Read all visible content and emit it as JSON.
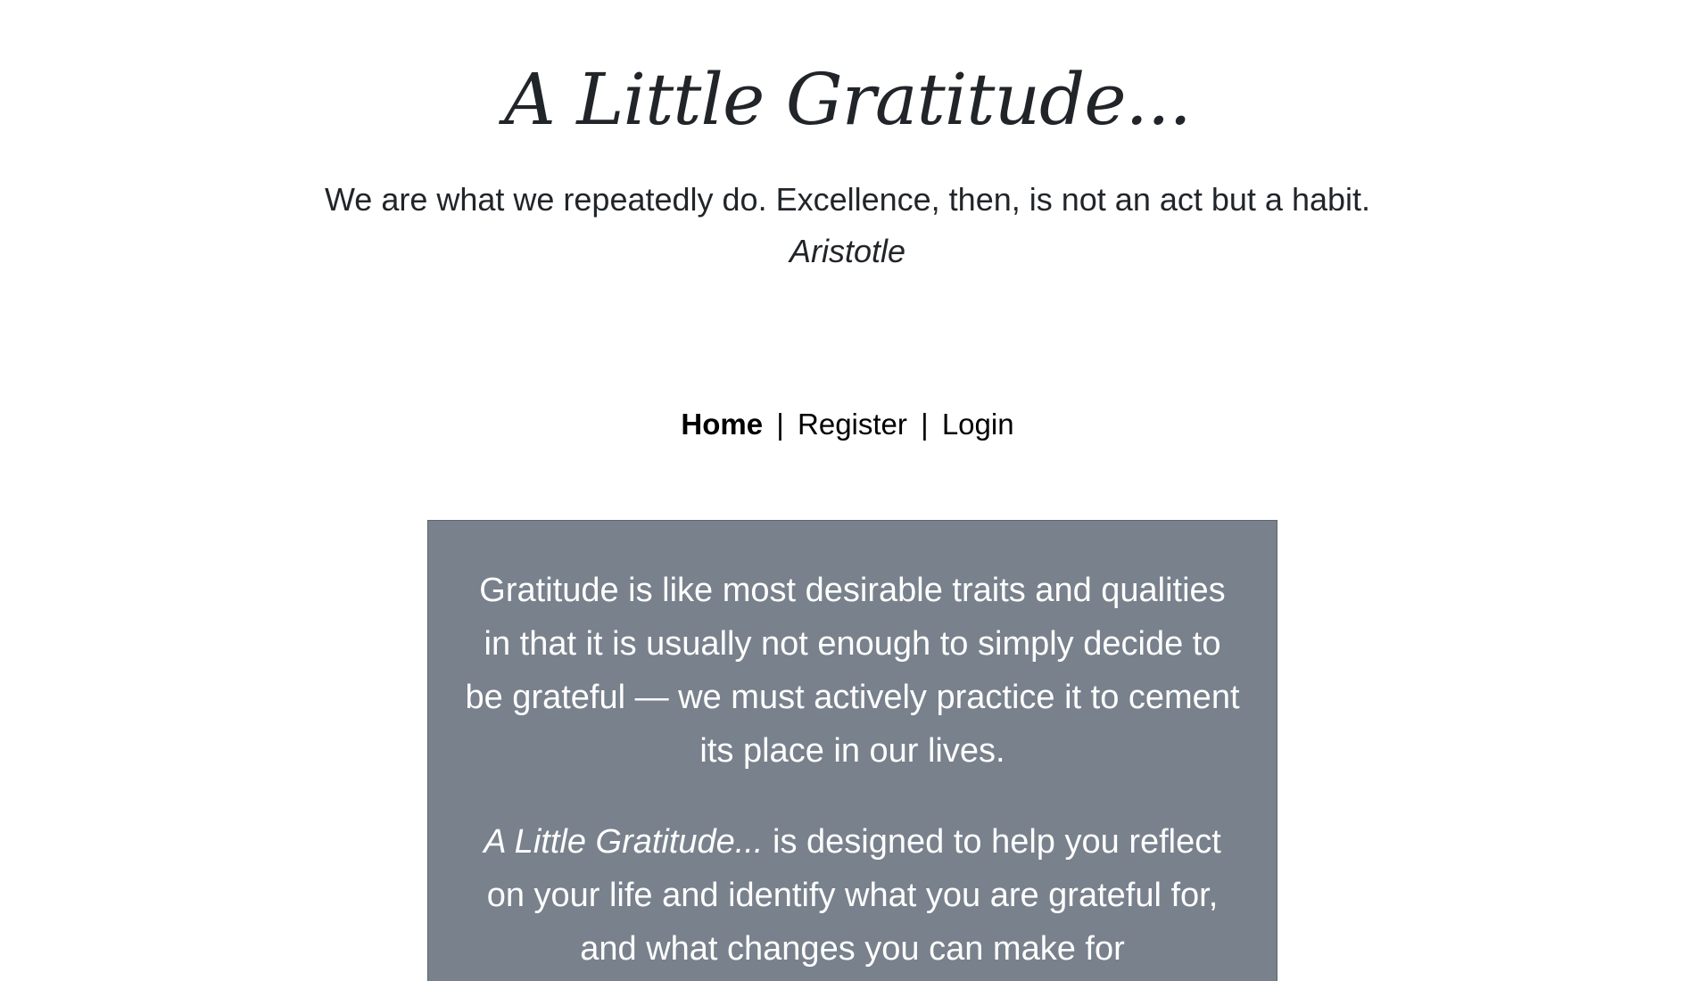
{
  "header": {
    "title": "A Little Gratitude..."
  },
  "quote": {
    "text": "We are what we repeatedly do. Excellence, then, is not an act but a habit.",
    "author": "Aristotle"
  },
  "nav": {
    "home": "Home",
    "separator": "|",
    "register": "Register",
    "login": "Login"
  },
  "intro": {
    "paragraph1": "Gratitude is like most desirable traits and qualities in that it is usually not enough to simply decide to be grateful — we must actively practice it to cement its place in our lives.",
    "app_name": "A Little Gratitude...",
    "paragraph2_rest": " is designed to help you reflect on your life and identify what you are grateful for, and what changes you can make for"
  },
  "colors": {
    "box_background": "#78818c",
    "text_dark": "#212529",
    "box_text": "#ffffff"
  }
}
